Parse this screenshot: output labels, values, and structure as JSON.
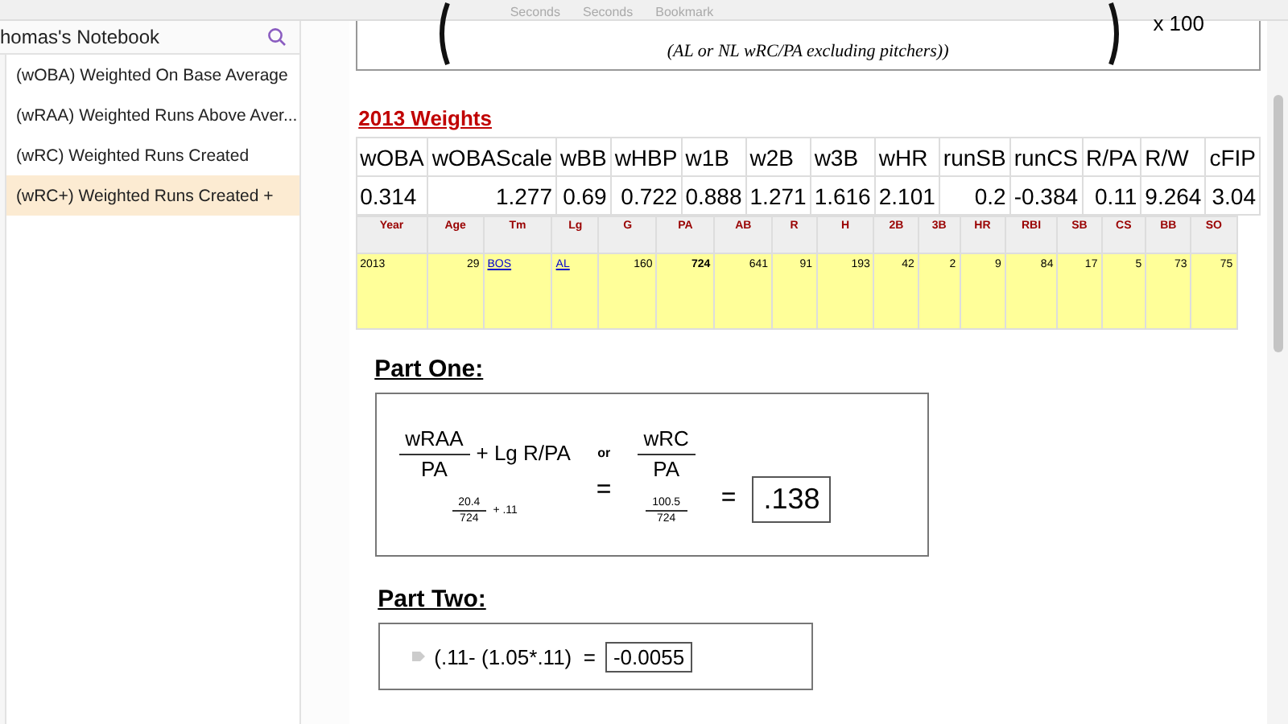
{
  "toolbar": {
    "labels": [
      "Seconds",
      "Seconds",
      "Bookmark"
    ]
  },
  "sidebar": {
    "notebook": "homas's Notebook",
    "pages": [
      {
        "label": "(wOBA) Weighted On Base Average",
        "selected": false
      },
      {
        "label": "(wRAA) Weighted Runs Above Aver...",
        "selected": false
      },
      {
        "label": "(wRC) Weighted Runs Created",
        "selected": false
      },
      {
        "label": "(wRC+) Weighted Runs Created +",
        "selected": true
      }
    ]
  },
  "formula": {
    "denominator": "(AL or NL wRC/PA excluding pitchers))",
    "multiplier": "x 100"
  },
  "weights": {
    "title": "2013 Weights",
    "columns": [
      "wOBA",
      "wOBAScale",
      "wBB",
      "wHBP",
      "w1B",
      "w2B",
      "w3B",
      "wHR",
      "runSB",
      "runCS",
      "R/PA",
      "R/W",
      "cFIP"
    ],
    "values": [
      "0.314",
      "1.277",
      "0.69",
      "0.722",
      "0.888",
      "1.271",
      "1.616",
      "2.101",
      "0.2",
      "-0.384",
      "0.11",
      "9.264",
      "3.04"
    ]
  },
  "stats": {
    "columns": [
      "Year",
      "Age",
      "Tm",
      "Lg",
      "G",
      "PA",
      "AB",
      "R",
      "H",
      "2B",
      "3B",
      "HR",
      "RBI",
      "SB",
      "CS",
      "BB",
      "SO"
    ],
    "rows": [
      [
        {
          "text": "2013",
          "kind": "left"
        },
        {
          "text": "29",
          "kind": "num"
        },
        {
          "text": "BOS",
          "kind": "link"
        },
        {
          "text": "AL",
          "kind": "link"
        },
        {
          "text": "160",
          "kind": "num"
        },
        {
          "text": "724",
          "kind": "bold"
        },
        {
          "text": "641",
          "kind": "num"
        },
        {
          "text": "91",
          "kind": "num"
        },
        {
          "text": "193",
          "kind": "num"
        },
        {
          "text": "42",
          "kind": "num"
        },
        {
          "text": "2",
          "kind": "num"
        },
        {
          "text": "9",
          "kind": "num"
        },
        {
          "text": "84",
          "kind": "num"
        },
        {
          "text": "17",
          "kind": "num"
        },
        {
          "text": "5",
          "kind": "num"
        },
        {
          "text": "73",
          "kind": "num"
        },
        {
          "text": "75",
          "kind": "num"
        }
      ]
    ]
  },
  "part_one": {
    "heading": "Part One:",
    "left": {
      "numerator": "wRAA",
      "denominator": "PA",
      "addend": "+ Lg R/PA",
      "value_num": "20.4",
      "value_den": "724",
      "value_add": "+ .11"
    },
    "or": "or",
    "right": {
      "numerator": "wRC",
      "denominator": "PA",
      "value_num": "100.5",
      "value_den": "724"
    },
    "equals": [
      "=",
      "="
    ],
    "result": ".138"
  },
  "part_two": {
    "heading": "Part Two:",
    "expression": "(.11- (1.05*.11)  =",
    "result": "-0.0055"
  }
}
